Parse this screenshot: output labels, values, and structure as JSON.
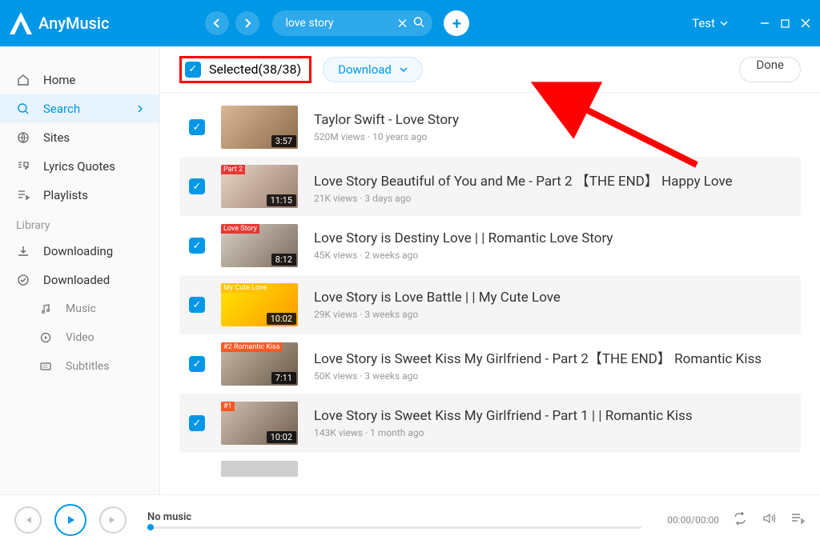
{
  "app": {
    "name": "AnyMusic"
  },
  "header": {
    "search_value": "love story",
    "test_label": "Test"
  },
  "sidebar": {
    "items": [
      {
        "label": "Home"
      },
      {
        "label": "Search"
      },
      {
        "label": "Sites"
      },
      {
        "label": "Lyrics Quotes"
      },
      {
        "label": "Playlists"
      }
    ],
    "library_label": "Library",
    "library_items": [
      {
        "label": "Downloading"
      },
      {
        "label": "Downloaded"
      }
    ],
    "sub_items": [
      {
        "label": "Music"
      },
      {
        "label": "Video"
      },
      {
        "label": "Subtitles"
      }
    ]
  },
  "toolbar": {
    "selected_label": "Selected(38/38)",
    "download_label": "Download",
    "done_label": "Done"
  },
  "results": [
    {
      "title": "Taylor Swift - Love Story",
      "views": "520M views",
      "age": "10 years ago",
      "duration": "3:57"
    },
    {
      "title": "Love Story Beautiful of You and Me - Part 2 【THE END】 Happy Love",
      "views": "21K views",
      "age": "3 days ago",
      "duration": "11:15"
    },
    {
      "title": "Love Story is Destiny Love | | Romantic Love Story",
      "views": "45K views",
      "age": "2 weeks ago",
      "duration": "8:12"
    },
    {
      "title": "Love Story is Love Battle | | My Cute Love",
      "views": "29K views",
      "age": "3 weeks ago",
      "duration": "10:02"
    },
    {
      "title": "Love Story is Sweet Kiss My Girlfriend - Part 2【THE END】 Romantic Kiss",
      "views": "50K views",
      "age": "3 weeks ago",
      "duration": "7:11"
    },
    {
      "title": "Love Story is Sweet Kiss My Girlfriend - Part 1 | | Romantic Kiss",
      "views": "143K views",
      "age": "1 month ago",
      "duration": "10:02"
    }
  ],
  "player": {
    "now_playing": "No music",
    "time": "00:00/00:00"
  }
}
